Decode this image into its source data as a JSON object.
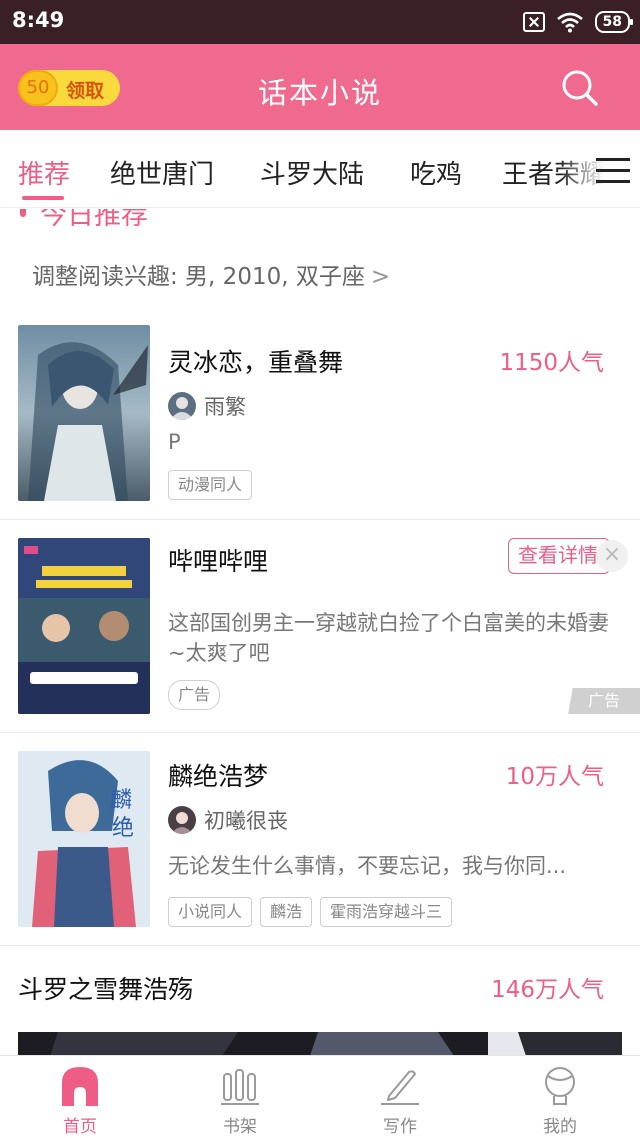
{
  "status_bar": {
    "time": "8:49",
    "battery": "58"
  },
  "header": {
    "coin_amount": "50",
    "claim_label": "领取",
    "title": "话本小说"
  },
  "tabs": [
    "推荐",
    "绝世唐门",
    "斗罗大陆",
    "吃鸡",
    "王者荣耀"
  ],
  "section": {
    "title": "今日推荐",
    "preference_text": "调整阅读兴趣: 男, 2010, 双子座",
    "chevron": ">"
  },
  "cards": [
    {
      "title": "灵冰恋，重叠舞",
      "popularity": "1150人气",
      "author": "雨繁",
      "desc": "P",
      "tags": [
        "动漫同人"
      ]
    },
    {
      "title": "哔哩哔哩",
      "detail_button": "查看详情",
      "close": "×",
      "desc": "这部国创男主一穿越就白捡了个白富美的未婚妻~太爽了吧",
      "tag": "广告",
      "ad_mark": "广告"
    },
    {
      "title": "麟绝浩梦",
      "popularity": "10万人气",
      "author": "初曦很丧",
      "desc": "无论发生什么事情，不要忘记，我与你同...",
      "tags": [
        "小说同人",
        "麟浩",
        "霍雨浩穿越斗三"
      ]
    },
    {
      "title": "斗罗之雪舞浩殇",
      "popularity": "146万人气"
    }
  ],
  "bottom_nav": [
    "首页",
    "书架",
    "写作",
    "我的"
  ],
  "colors": {
    "accent": "#ee5d85",
    "header_bg": "#f06a8f",
    "status_bg": "#3a1f26"
  }
}
